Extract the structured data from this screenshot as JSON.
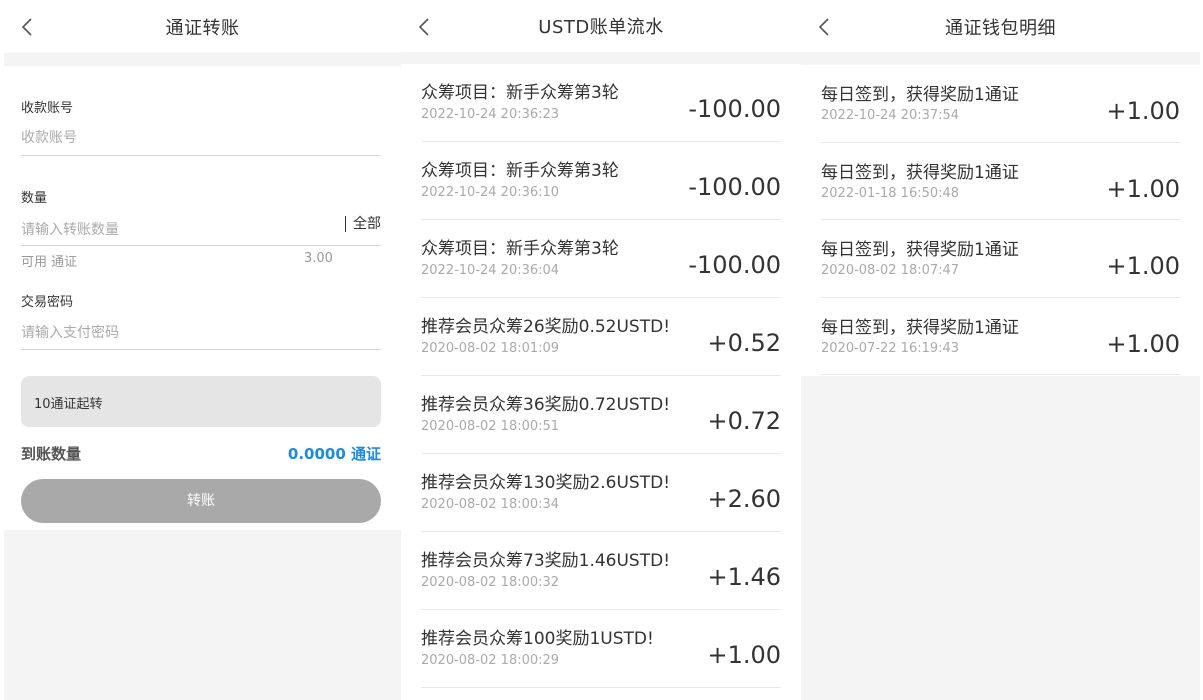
{
  "transfer": {
    "title": "通证转账",
    "payee_label": "收款账号",
    "payee_placeholder": "收款账号",
    "qty_label": "数量",
    "qty_placeholder": "请输入转账数量",
    "all_label": "全部",
    "available_label": "可用 通证",
    "available_value": "3.00",
    "pwd_label": "交易密码",
    "pwd_placeholder": "请输入支付密码",
    "notice": "10通证起转",
    "receive_label": "到账数量",
    "receive_value": "0.0000 通证",
    "submit_label": "转账"
  },
  "ustd": {
    "title": "USTD账单流水",
    "items": [
      {
        "text": "众筹项目：新手众筹第3轮",
        "date": "2022-10-24 20:36:23",
        "amount": "-100.00"
      },
      {
        "text": "众筹项目：新手众筹第3轮",
        "date": "2022-10-24 20:36:10",
        "amount": "-100.00"
      },
      {
        "text": "众筹项目：新手众筹第3轮",
        "date": "2022-10-24 20:36:04",
        "amount": "-100.00"
      },
      {
        "text": "推荐会员众筹26奖励0.52USTD!",
        "date": "2020-08-02 18:01:09",
        "amount": "+0.52"
      },
      {
        "text": "推荐会员众筹36奖励0.72USTD!",
        "date": "2020-08-02 18:00:51",
        "amount": "+0.72"
      },
      {
        "text": "推荐会员众筹130奖励2.6USTD!",
        "date": "2020-08-02 18:00:34",
        "amount": "+2.60"
      },
      {
        "text": "推荐会员众筹73奖励1.46USTD!",
        "date": "2020-08-02 18:00:32",
        "amount": "+1.46"
      },
      {
        "text": "推荐会员众筹100奖励1USTD!",
        "date": "2020-08-02 18:00:29",
        "amount": "+1.00"
      }
    ]
  },
  "wallet": {
    "title": "通证钱包明细",
    "items": [
      {
        "text": "每日签到，获得奖励1通证",
        "date": "2022-10-24 20:37:54",
        "amount": "+1.00"
      },
      {
        "text": "每日签到，获得奖励1通证",
        "date": "2022-01-18 16:50:48",
        "amount": "+1.00"
      },
      {
        "text": "每日签到，获得奖励1通证",
        "date": "2020-08-02 18:07:47",
        "amount": "+1.00"
      },
      {
        "text": "每日签到，获得奖励1通证",
        "date": "2020-07-22 16:19:43",
        "amount": "+1.00"
      }
    ]
  },
  "icons": {
    "back": "chevron-left-icon"
  },
  "colors": {
    "accent": "#1a8ae6",
    "button_disabled": "#a9a9a9",
    "page_bg": "#f4f4f4"
  }
}
